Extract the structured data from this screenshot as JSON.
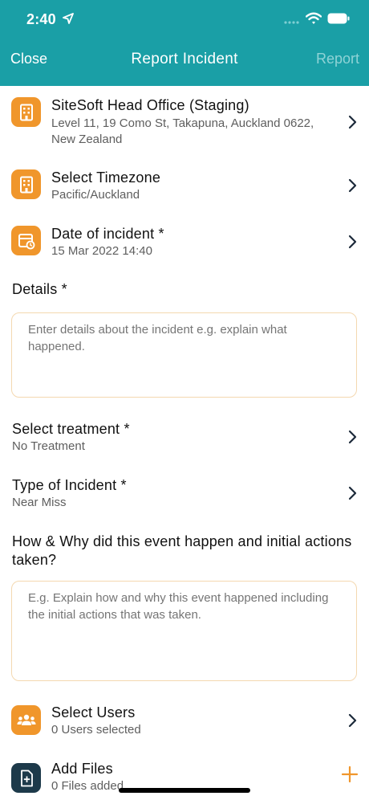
{
  "status_bar": {
    "time": "2:40"
  },
  "nav": {
    "close": "Close",
    "title": "Report Incident",
    "report": "Report"
  },
  "site": {
    "title": "SiteSoft Head Office (Staging)",
    "address": "Level 11, 19 Como St, Takapuna, Auckland 0622, New Zealand"
  },
  "timezone": {
    "title": "Select Timezone",
    "value": "Pacific/Auckland"
  },
  "date": {
    "title": "Date of incident *",
    "value": "15 Mar 2022 14:40"
  },
  "details": {
    "label": "Details *",
    "placeholder": "Enter details about the incident e.g. explain what happened."
  },
  "treatment": {
    "label": "Select treatment *",
    "value": "No Treatment"
  },
  "incident_type": {
    "label": "Type of Incident *",
    "value": "Near Miss"
  },
  "how_why": {
    "label": "How & Why did this event happen and initial actions taken?",
    "placeholder": "E.g. Explain how and why this event happened including the initial actions that was taken."
  },
  "users": {
    "title": "Select Users",
    "value": "0 Users selected"
  },
  "files": {
    "title": "Add Files",
    "value": "0 Files added"
  },
  "colors": {
    "header": "#1a9fa6",
    "accent": "#f0962b",
    "dark_icon": "#1d3a4a"
  }
}
